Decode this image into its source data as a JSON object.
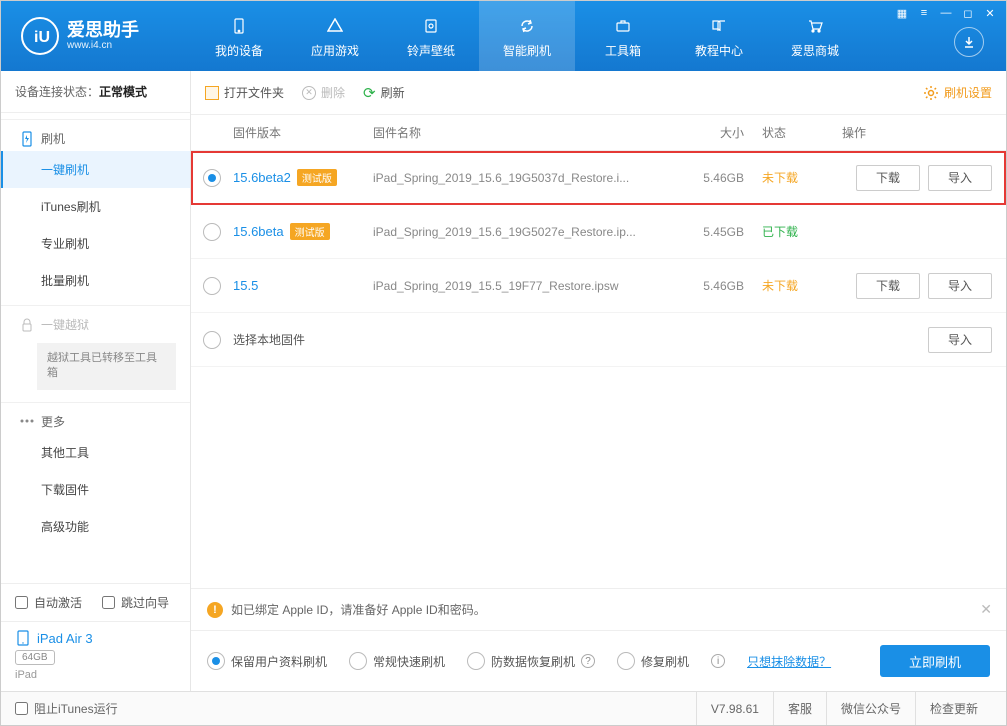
{
  "app": {
    "name": "爱思助手",
    "site": "www.i4.cn"
  },
  "topnav": {
    "items": [
      {
        "label": "我的设备"
      },
      {
        "label": "应用游戏"
      },
      {
        "label": "铃声壁纸"
      },
      {
        "label": "智能刷机"
      },
      {
        "label": "工具箱"
      },
      {
        "label": "教程中心"
      },
      {
        "label": "爱思商城"
      }
    ]
  },
  "sidebar": {
    "status_label": "设备连接状态：",
    "status_value": "正常模式",
    "group_flash": "刷机",
    "items_flash": [
      "一键刷机",
      "iTunes刷机",
      "专业刷机",
      "批量刷机"
    ],
    "group_jailbreak": "一键越狱",
    "jailbreak_note": "越狱工具已转移至工具箱",
    "group_more": "更多",
    "items_more": [
      "其他工具",
      "下载固件",
      "高级功能"
    ],
    "auto_activate": "自动激活",
    "skip_guide": "跳过向导",
    "device_name": "iPad Air 3",
    "device_cap": "64GB",
    "device_type": "iPad"
  },
  "toolbar": {
    "open": "打开文件夹",
    "delete": "删除",
    "refresh": "刷新",
    "settings": "刷机设置"
  },
  "headers": {
    "version": "固件版本",
    "name": "固件名称",
    "size": "大小",
    "status": "状态",
    "op": "操作"
  },
  "rows": [
    {
      "version": "15.6beta2",
      "beta": "测试版",
      "name": "iPad_Spring_2019_15.6_19G5037d_Restore.i...",
      "size": "5.46GB",
      "status": "未下载",
      "selected": true,
      "hl": true,
      "ops": [
        "下载",
        "导入"
      ]
    },
    {
      "version": "15.6beta",
      "beta": "测试版",
      "name": "iPad_Spring_2019_15.6_19G5027e_Restore.ip...",
      "size": "5.45GB",
      "status": "已下载",
      "downloaded": true
    },
    {
      "version": "15.5",
      "name": "iPad_Spring_2019_15.5_19F77_Restore.ipsw",
      "size": "5.46GB",
      "status": "未下载",
      "ops": [
        "下载",
        "导入"
      ]
    },
    {
      "local": true,
      "label": "选择本地固件",
      "ops": [
        "导入"
      ]
    }
  ],
  "alert": "如已绑定 Apple ID，请准备好 Apple ID和密码。",
  "modes": {
    "opts": [
      "保留用户资料刷机",
      "常规快速刷机",
      "防数据恢复刷机",
      "修复刷机"
    ],
    "erase_link": "只想抹除数据？",
    "flash_btn": "立即刷机"
  },
  "statusbar": {
    "block_itunes": "阻止iTunes运行",
    "version": "V7.98.61",
    "kefu": "客服",
    "wechat": "微信公众号",
    "update": "检查更新"
  }
}
